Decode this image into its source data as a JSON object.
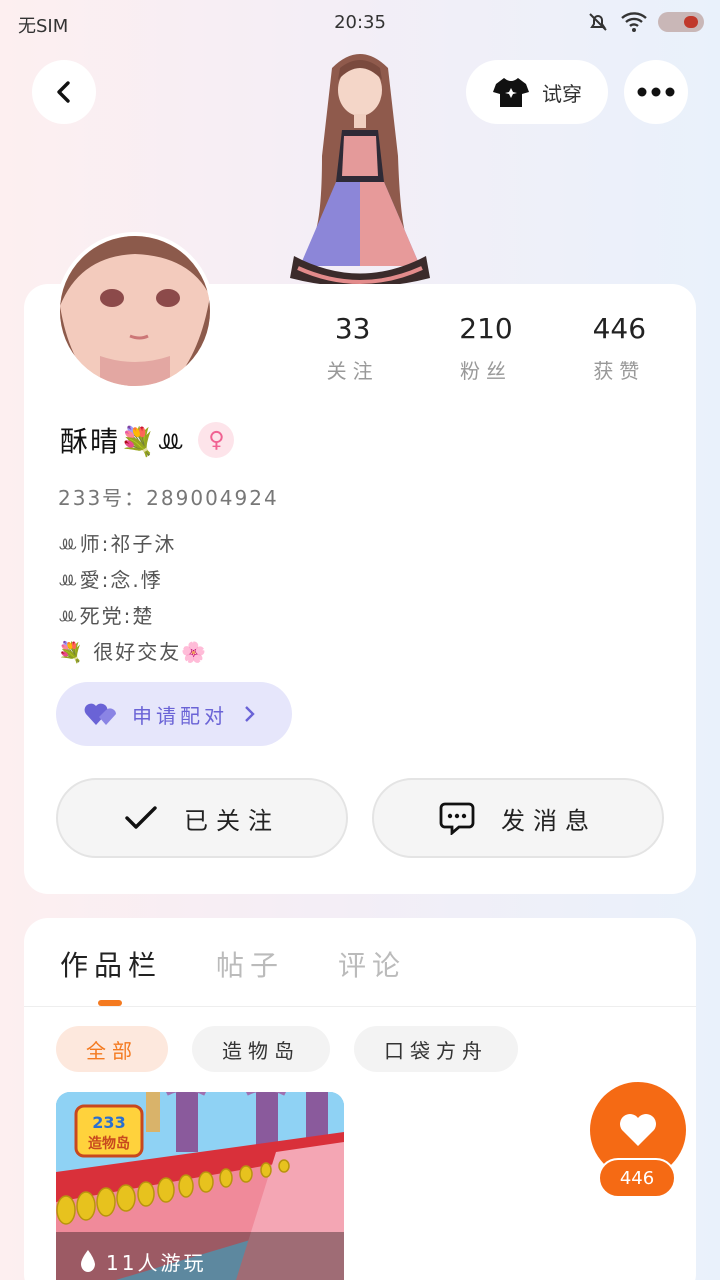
{
  "status_bar": {
    "carrier": "无SIM",
    "time": "20:35"
  },
  "header": {
    "tryon_label": "试穿"
  },
  "stats": [
    {
      "value": "33",
      "label": "关注"
    },
    {
      "value": "210",
      "label": "粉丝"
    },
    {
      "value": "446",
      "label": "获赞"
    }
  ],
  "profile": {
    "name": "酥晴💐ꔛ",
    "uid": "233号：289004924",
    "bio": [
      "ꔛ师:祁子沐",
      "ꔛ愛:念.悸",
      "ꔛ死党:楚",
      "💐 很好交友🌸"
    ]
  },
  "pair_button": "申请配对",
  "follow_button": "已关注",
  "message_button": "发消息",
  "tabs": [
    "作品栏",
    "帖子",
    "评论"
  ],
  "chips": [
    "全部",
    "造物岛",
    "口袋方舟"
  ],
  "game": {
    "logo_text": "233造物岛",
    "plays": "11人游玩"
  },
  "like_count": "446",
  "colors": {
    "accent": "#f47a20",
    "pair_accent": "#6a63d6",
    "gender": "#f06292"
  }
}
